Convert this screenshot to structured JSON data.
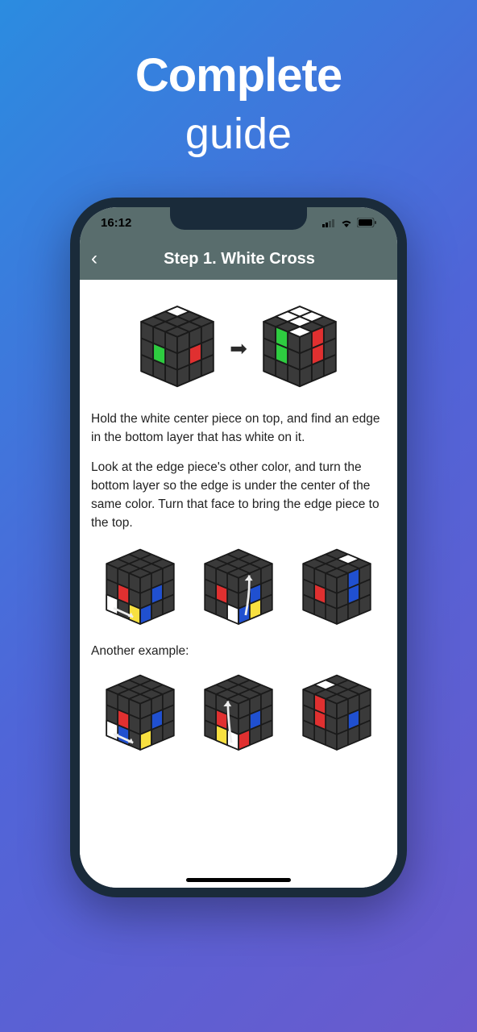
{
  "hero": {
    "bold": "Complete",
    "light": "guide"
  },
  "status": {
    "time": "16:12"
  },
  "appbar": {
    "title": "Step 1. White Cross"
  },
  "text": {
    "p1": "Hold the white center piece on top, and find an edge in the bottom layer that has white on it.",
    "p2": "Look at the edge piece's other color, and turn the bottom layer so the edge is under the center of the same color. Turn that face to bring the edge piece to the top.",
    "label": "Another example:"
  },
  "colors": {
    "cube_dark": "#3a3a3a",
    "cube_line": "#1a1a1a",
    "white": "#ffffff",
    "green": "#2ecc40",
    "red": "#e03030",
    "blue": "#2050d0",
    "yellow": "#f8e040"
  }
}
